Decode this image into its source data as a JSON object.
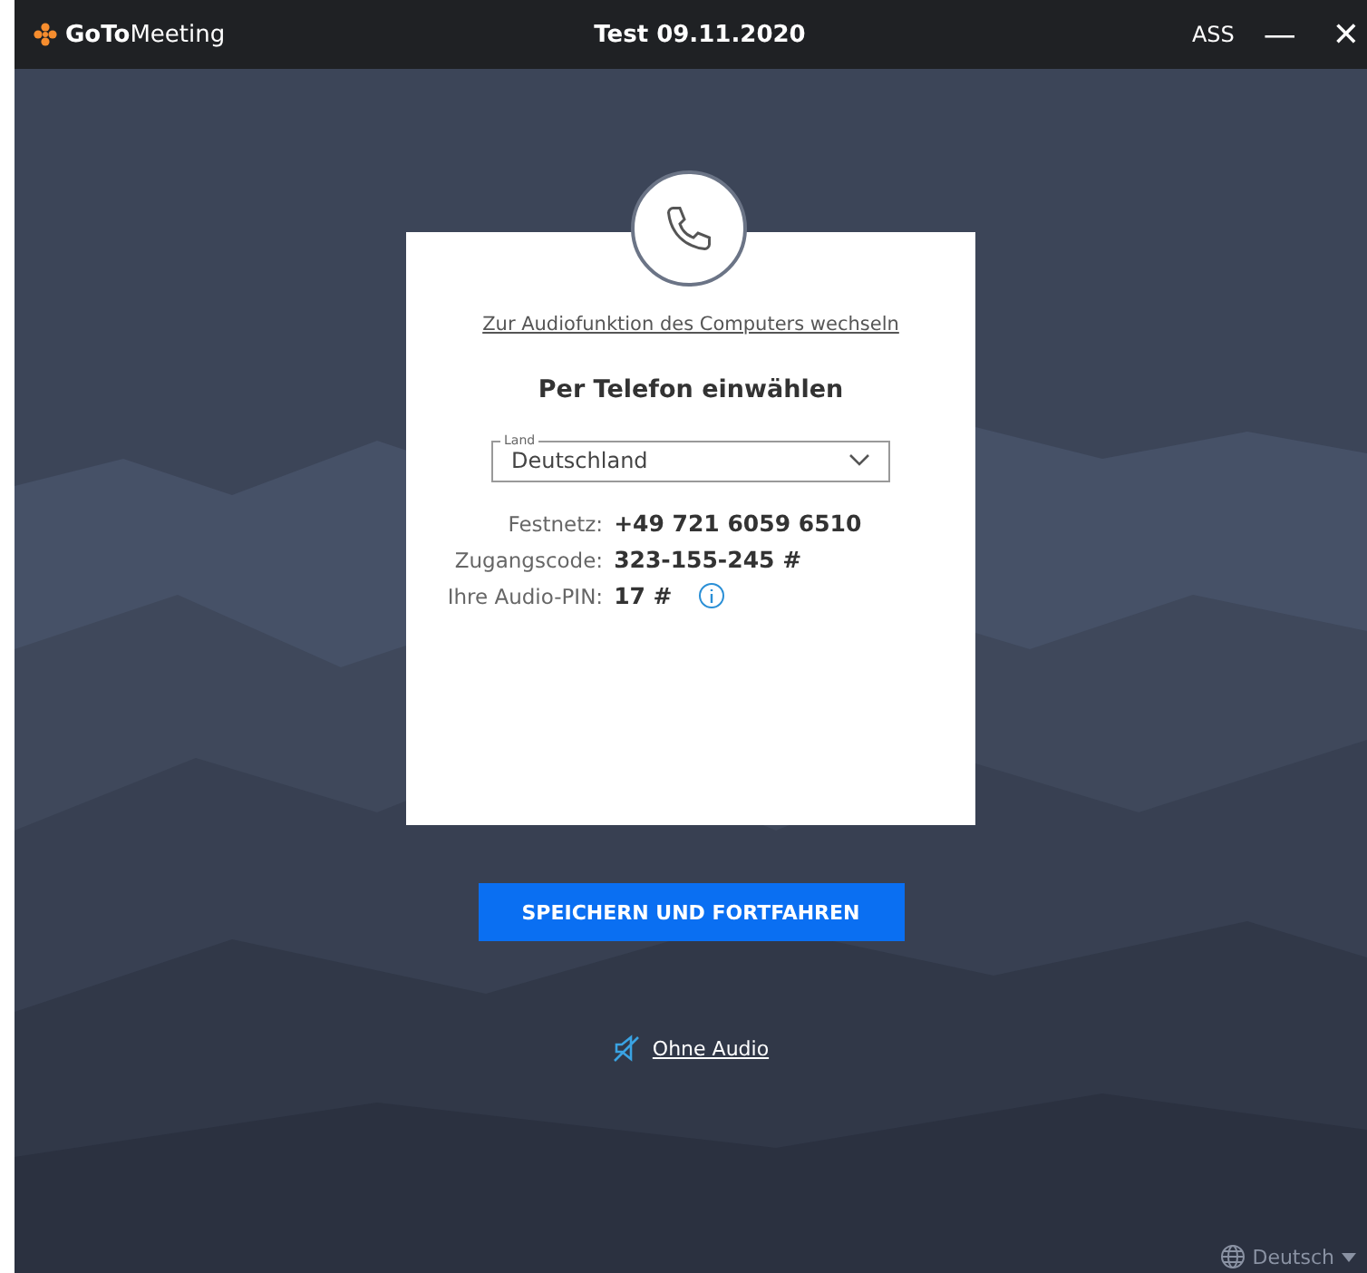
{
  "window": {
    "logo_bold": "GoTo",
    "logo_light": "Meeting",
    "title": "Test 09.11.2020",
    "user": "ASS",
    "minimize": "—",
    "close": "✕"
  },
  "card": {
    "switch_link": "Zur Audiofunktion des Computers wechseln",
    "heading": "Per Telefon einwählen",
    "country": {
      "label": "Land",
      "value": "Deutschland"
    },
    "details": [
      {
        "label": "Festnetz:",
        "value": "+49 721 6059 6510",
        "info": false
      },
      {
        "label": "Zugangscode:",
        "value": "323-155-245 #",
        "info": false
      },
      {
        "label": "Ihre Audio-PIN:",
        "value": "17 #",
        "info": true
      }
    ]
  },
  "save_button": "SPEICHERN UND FORTFAHREN",
  "no_audio": "Ohne Audio",
  "language": "Deutsch"
}
